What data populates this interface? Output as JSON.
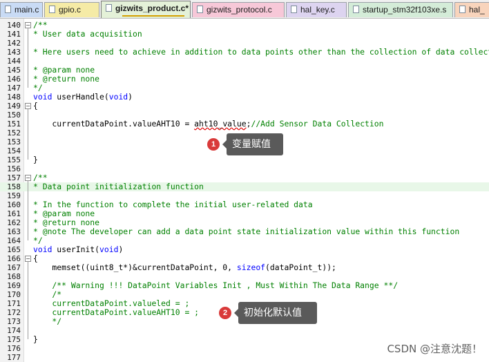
{
  "tabs": [
    {
      "label": "main.c",
      "color": "#c9dbf5",
      "active": false
    },
    {
      "label": "gpio.c",
      "color": "#f5eba6",
      "active": false
    },
    {
      "label": "gizwits_product.c*",
      "color": "#e4f1d8",
      "active": true
    },
    {
      "label": "gizwits_protocol.c",
      "color": "#f7c8d8",
      "active": false
    },
    {
      "label": "hal_key.c",
      "color": "#ddd4f0",
      "active": false
    },
    {
      "label": "startup_stm32f103xe.s",
      "color": "#d4ecd8",
      "active": false
    },
    {
      "label": "hal_",
      "color": "#f8d4bc",
      "active": false
    }
  ],
  "code_lines": [
    {
      "n": "140",
      "fold": "minus",
      "seg": [
        {
          "t": "/**",
          "c": "cm"
        }
      ]
    },
    {
      "n": "141",
      "seg": [
        {
          "t": "* User data acquisition",
          "c": "cm"
        }
      ]
    },
    {
      "n": "142",
      "seg": []
    },
    {
      "n": "143",
      "seg": [
        {
          "t": "* Here users need to achieve in addition to data points other than the collection of data collection",
          "c": "cm"
        }
      ]
    },
    {
      "n": "144",
      "seg": []
    },
    {
      "n": "145",
      "seg": [
        {
          "t": "* @param none",
          "c": "cm"
        }
      ]
    },
    {
      "n": "146",
      "seg": [
        {
          "t": "* @return none",
          "c": "cm"
        }
      ]
    },
    {
      "n": "147",
      "seg": [
        {
          "t": "*/",
          "c": "cm"
        }
      ]
    },
    {
      "n": "148",
      "seg": [
        {
          "t": "void",
          "c": "kw"
        },
        {
          "t": " userHandle("
        },
        {
          "t": "void",
          "c": "kw"
        },
        {
          "t": ")"
        }
      ]
    },
    {
      "n": "149",
      "fold": "minus",
      "seg": [
        {
          "t": "{"
        }
      ]
    },
    {
      "n": "150",
      "seg": []
    },
    {
      "n": "151",
      "seg": [
        {
          "t": "    currentDataPoint.valueAHT10 = "
        },
        {
          "t": "aht10_value",
          "c": "squig"
        },
        {
          "t": ";"
        },
        {
          "t": "//Add Sensor Data Collection",
          "c": "cm"
        }
      ]
    },
    {
      "n": "152",
      "seg": []
    },
    {
      "n": "153",
      "seg": []
    },
    {
      "n": "154",
      "seg": []
    },
    {
      "n": "155",
      "seg": [
        {
          "t": "}"
        }
      ]
    },
    {
      "n": "156",
      "seg": []
    },
    {
      "n": "157",
      "fold": "minus",
      "seg": [
        {
          "t": "/**",
          "c": "cm"
        }
      ]
    },
    {
      "n": "158",
      "hl": true,
      "seg": [
        {
          "t": "* Data point initialization function",
          "c": "cm"
        }
      ]
    },
    {
      "n": "159",
      "seg": []
    },
    {
      "n": "160",
      "seg": [
        {
          "t": "* In the function to complete the initial user-related data",
          "c": "cm"
        }
      ]
    },
    {
      "n": "161",
      "seg": [
        {
          "t": "* @param none",
          "c": "cm"
        }
      ]
    },
    {
      "n": "162",
      "seg": [
        {
          "t": "* @return none",
          "c": "cm"
        }
      ]
    },
    {
      "n": "163",
      "seg": [
        {
          "t": "* @note The developer can add a data point state initialization value within this function",
          "c": "cm"
        }
      ]
    },
    {
      "n": "164",
      "seg": [
        {
          "t": "*/",
          "c": "cm"
        }
      ]
    },
    {
      "n": "165",
      "seg": [
        {
          "t": "void",
          "c": "kw"
        },
        {
          "t": " userInit("
        },
        {
          "t": "void",
          "c": "kw"
        },
        {
          "t": ")"
        }
      ]
    },
    {
      "n": "166",
      "fold": "minus",
      "seg": [
        {
          "t": "{"
        }
      ]
    },
    {
      "n": "167",
      "seg": [
        {
          "t": "    memset((uint8_t*)&currentDataPoint, 0, "
        },
        {
          "t": "sizeof",
          "c": "kw"
        },
        {
          "t": "(dataPoint_t));"
        }
      ]
    },
    {
      "n": "168",
      "seg": []
    },
    {
      "n": "169",
      "seg": [
        {
          "t": "    /** Warning !!! DataPoint Variables Init , Must Within The Data Range **/",
          "c": "cm"
        }
      ]
    },
    {
      "n": "170",
      "seg": [
        {
          "t": "    /*",
          "c": "cm"
        }
      ]
    },
    {
      "n": "171",
      "seg": [
        {
          "t": "    currentDataPoint.valueled = ;",
          "c": "cm"
        }
      ]
    },
    {
      "n": "172",
      "seg": [
        {
          "t": "    currentDataPoint.valueAHT10 = ;",
          "c": "cm"
        }
      ]
    },
    {
      "n": "173",
      "seg": [
        {
          "t": "    */",
          "c": "cm"
        }
      ]
    },
    {
      "n": "174",
      "seg": []
    },
    {
      "n": "175",
      "seg": [
        {
          "t": "}"
        }
      ]
    },
    {
      "n": "176",
      "seg": []
    },
    {
      "n": "177",
      "seg": []
    }
  ],
  "annotations": [
    {
      "num": "1",
      "label": "变量赋值"
    },
    {
      "num": "2",
      "label": "初始化默认值"
    }
  ],
  "watermark": "CSDN @注意沈题！"
}
